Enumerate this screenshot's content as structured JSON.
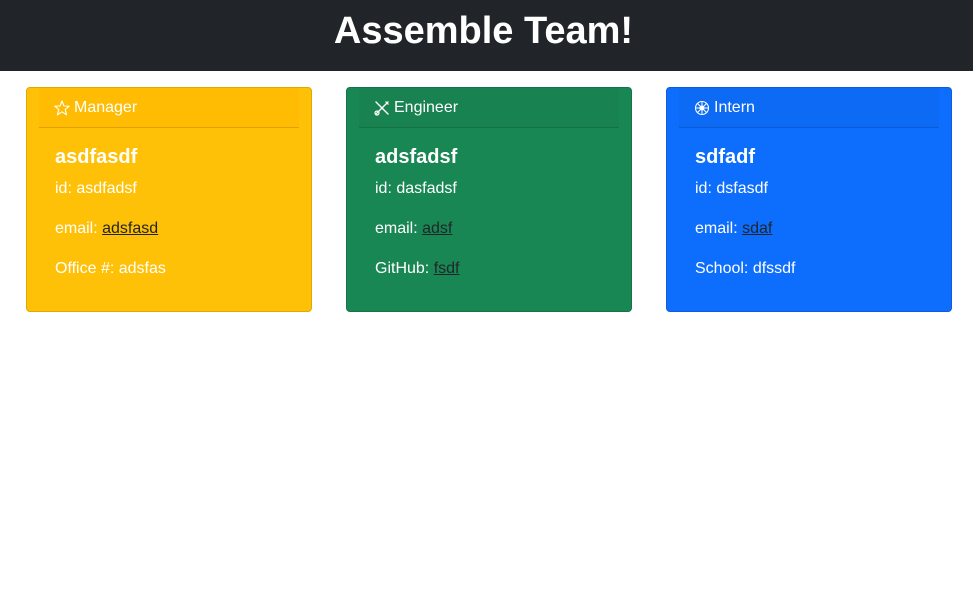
{
  "header": {
    "title": "Assemble Team!"
  },
  "cards": [
    {
      "role": "Manager",
      "icon": "star-icon",
      "name": "asdfasdf",
      "id_label": "id: ",
      "id_value": "asdfadsf",
      "email_label": "email: ",
      "email_value": "adsfasd",
      "extra_label": "Office #: ",
      "extra_value": "adsfas",
      "color": "#ffc107"
    },
    {
      "role": "Engineer",
      "icon": "tools-icon",
      "name": "adsfadsf",
      "id_label": "id: ",
      "id_value": "dasfadsf",
      "email_label": "email: ",
      "email_value": "adsf",
      "extra_label": "GitHub: ",
      "extra_value": "fsdf",
      "color": "#198754"
    },
    {
      "role": "Intern",
      "icon": "snowflake-icon",
      "name": "sdfadf",
      "id_label": "id: ",
      "id_value": "dsfasdf",
      "email_label": "email: ",
      "email_value": "sdaf",
      "extra_label": "School: ",
      "extra_value": "dfssdf",
      "color": "#0d6efd"
    }
  ]
}
